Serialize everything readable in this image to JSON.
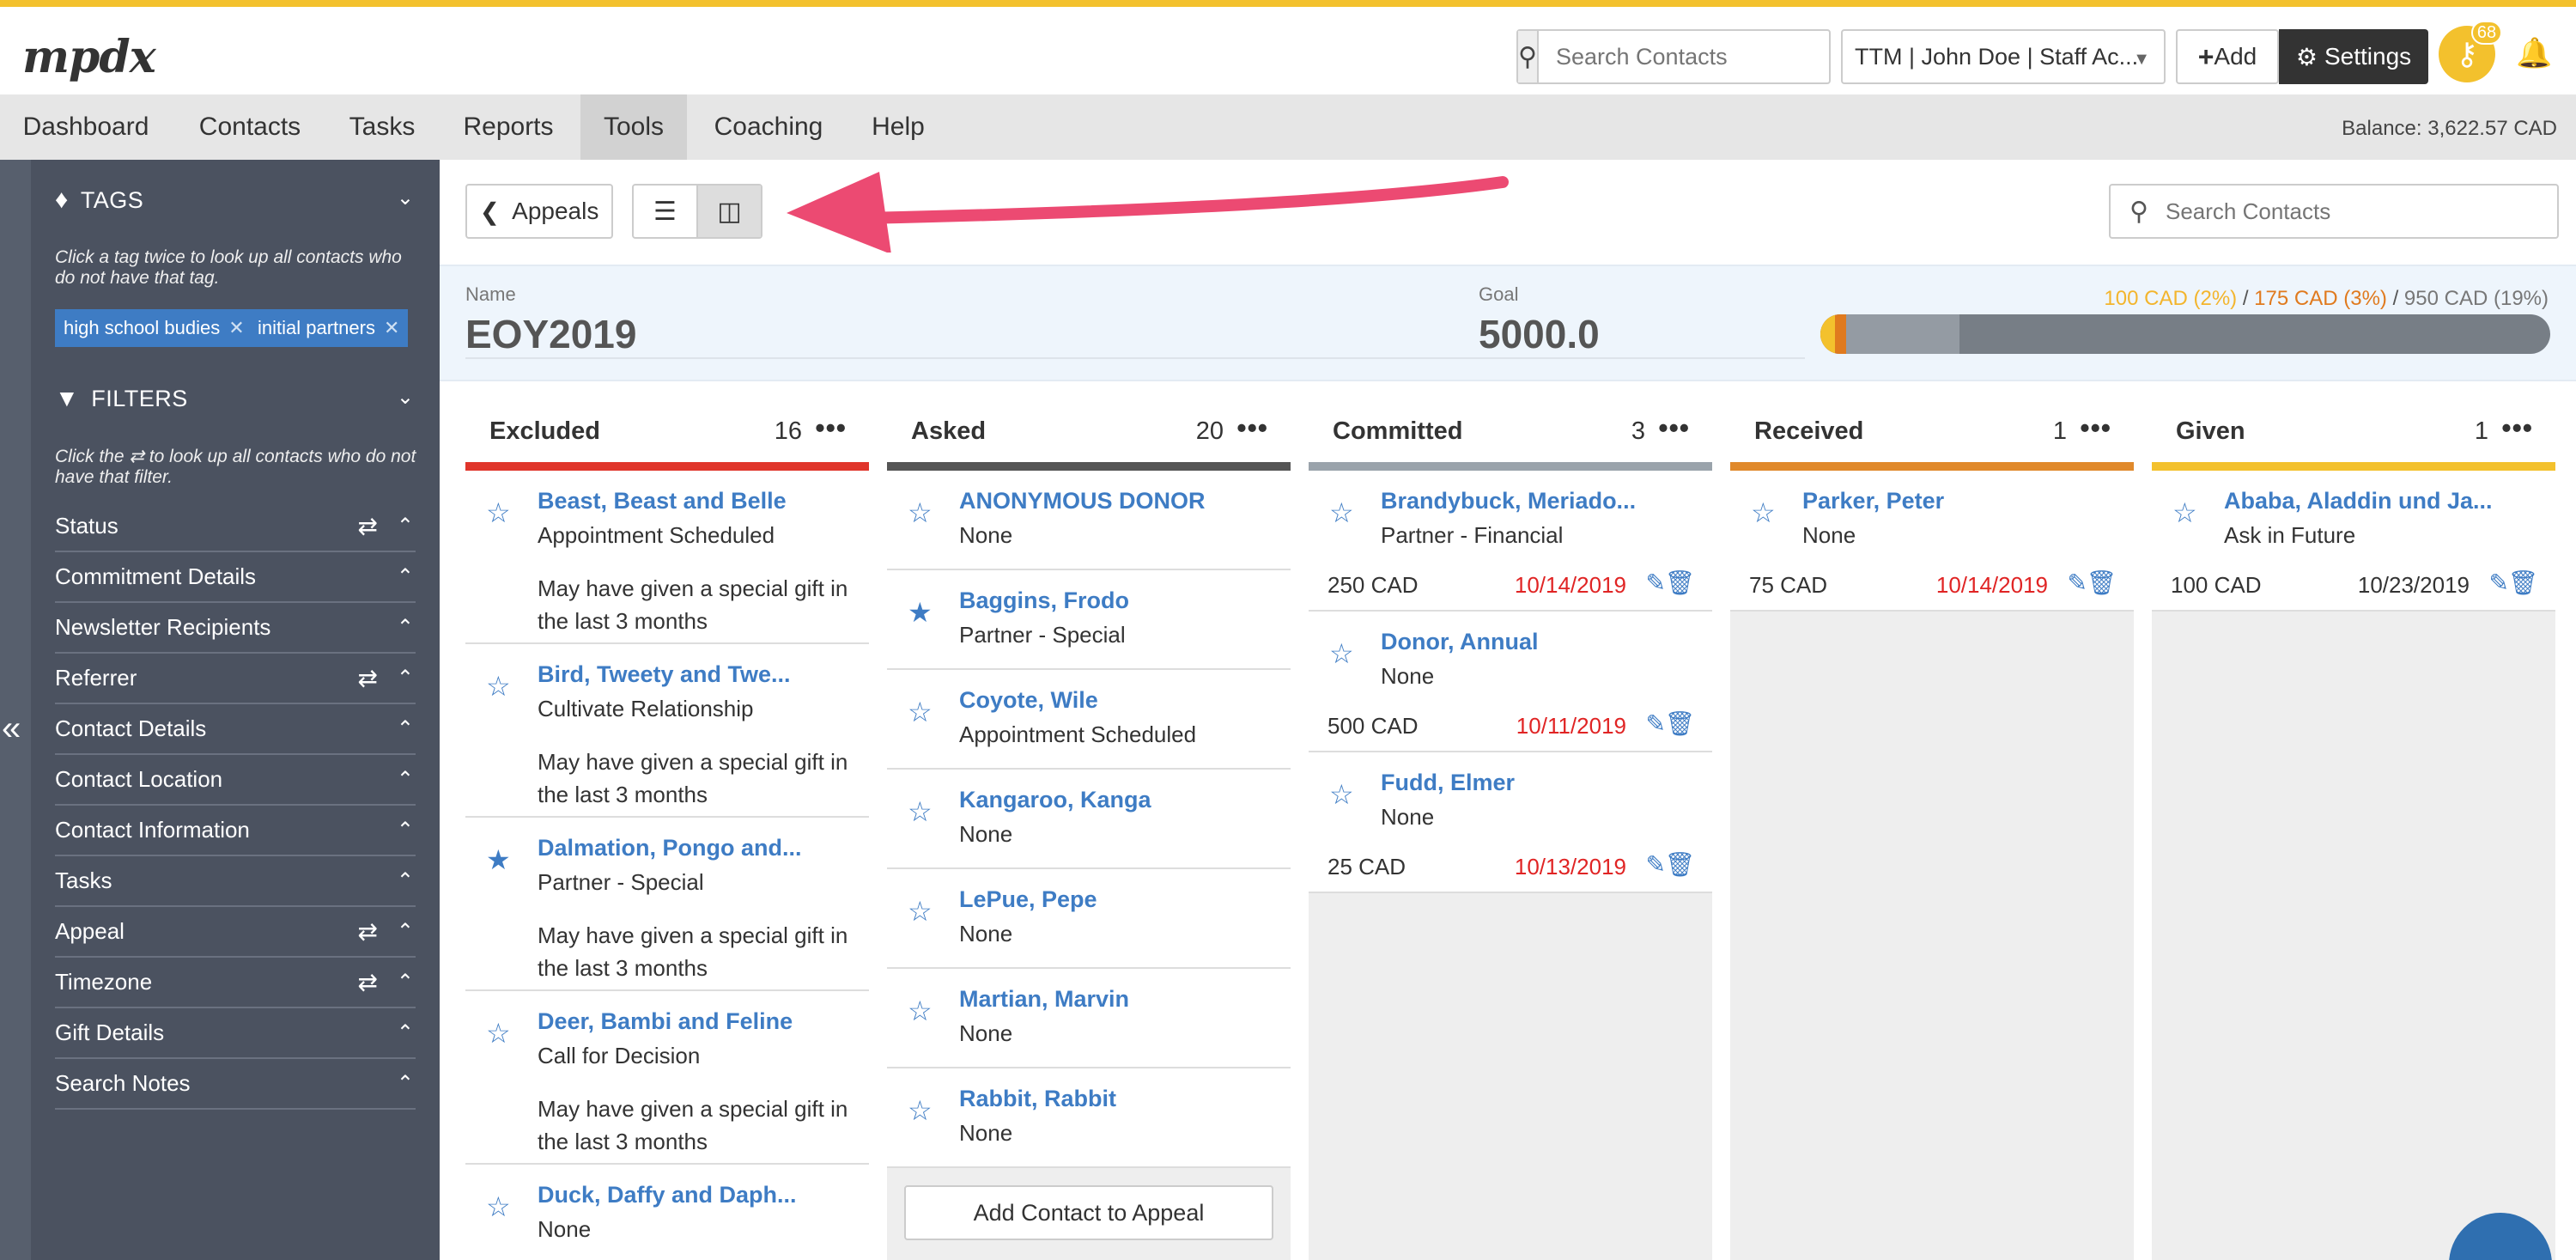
{
  "topbar": {
    "logo": "mpdx",
    "search_placeholder": "Search Contacts",
    "account": "TTM | John Doe | Staff Ac...",
    "add_label": "Add",
    "settings_label": "Settings",
    "notification_count": "68"
  },
  "nav": {
    "items": [
      "Dashboard",
      "Contacts",
      "Tasks",
      "Reports",
      "Tools",
      "Coaching",
      "Help"
    ],
    "active": "Tools",
    "balance": "Balance: 3,622.57 CAD"
  },
  "sidebar": {
    "tags_heading": "TAGS",
    "tags_hint": "Click a tag twice to look up all contacts who do not have that tag.",
    "tags": [
      "high school budies",
      "initial partners"
    ],
    "filters_heading": "FILTERS",
    "filters_hint": "Click the ⇄ to look up all contacts who do not have that filter.",
    "filters": [
      {
        "label": "Status",
        "swap": true
      },
      {
        "label": "Commitment Details",
        "swap": false
      },
      {
        "label": "Newsletter Recipients",
        "swap": false
      },
      {
        "label": "Referrer",
        "swap": true
      },
      {
        "label": "Contact Details",
        "swap": false
      },
      {
        "label": "Contact Location",
        "swap": false
      },
      {
        "label": "Contact Information",
        "swap": false
      },
      {
        "label": "Tasks",
        "swap": false
      },
      {
        "label": "Appeal",
        "swap": true
      },
      {
        "label": "Timezone",
        "swap": true
      },
      {
        "label": "Gift Details",
        "swap": false
      },
      {
        "label": "Search Notes",
        "swap": false
      }
    ]
  },
  "toolbar": {
    "back_label": "Appeals",
    "search_placeholder": "Search Contacts"
  },
  "appeal": {
    "name_label": "Name",
    "name": "EOY2019",
    "goal_label": "Goal",
    "goal": "5000.0",
    "amount_given": "100 CAD (2%)",
    "amount_received": "175 CAD (3%)",
    "amount_committed": "950 CAD (19%)",
    "progress": {
      "given": 0.02,
      "received": 0.035,
      "committed": 0.19
    }
  },
  "colors": {
    "excluded": "#e0352b",
    "asked": "#555555",
    "committed": "#9aa3ab",
    "received": "#e0892b",
    "given": "#f3c12d",
    "link": "#3e7cc4"
  },
  "columns": [
    {
      "title": "Excluded",
      "count": "16",
      "cards": [
        {
          "name": "Beast, Beast and Belle",
          "status": "Appointment Scheduled",
          "note": "May have given a special gift in the last 3 months",
          "starred": false
        },
        {
          "name": "Bird, Tweety and Twe...",
          "status": "Cultivate Relationship",
          "note": "May have given a special gift in the last 3 months",
          "starred": false
        },
        {
          "name": "Dalmation, Pongo and...",
          "status": "Partner - Special",
          "note": "May have given a special gift in the last 3 months",
          "starred": true
        },
        {
          "name": "Deer, Bambi and Feline",
          "status": "Call for Decision",
          "note": "May have given a special gift in the last 3 months",
          "starred": false
        },
        {
          "name": "Duck, Daffy and Daph...",
          "status": "None",
          "note": "",
          "starred": false
        }
      ]
    },
    {
      "title": "Asked",
      "count": "20",
      "cards": [
        {
          "name": "ANONYMOUS DONOR",
          "status": "None",
          "starred": false
        },
        {
          "name": "Baggins, Frodo",
          "status": "Partner - Special",
          "starred": true
        },
        {
          "name": "Coyote, Wile",
          "status": "Appointment Scheduled",
          "starred": false
        },
        {
          "name": "Kangaroo, Kanga",
          "status": "None",
          "starred": false
        },
        {
          "name": "LePue, Pepe",
          "status": "None",
          "starred": false
        },
        {
          "name": "Martian, Marvin",
          "status": "None",
          "starred": false
        },
        {
          "name": "Rabbit, Rabbit",
          "status": "None",
          "starred": false
        }
      ],
      "add_label": "Add Contact to Appeal"
    },
    {
      "title": "Committed",
      "count": "3",
      "cards": [
        {
          "name": "Brandybuck, Meriado...",
          "status": "Partner - Financial",
          "amount": "250 CAD",
          "date": "10/14/2019",
          "starred": false
        },
        {
          "name": "Donor, Annual",
          "status": "None",
          "amount": "500 CAD",
          "date": "10/11/2019",
          "starred": false
        },
        {
          "name": "Fudd, Elmer",
          "status": "None",
          "amount": "25 CAD",
          "date": "10/13/2019",
          "starred": false
        }
      ]
    },
    {
      "title": "Received",
      "count": "1",
      "cards": [
        {
          "name": "Parker, Peter",
          "status": "None",
          "amount": "75 CAD",
          "date": "10/14/2019",
          "starred": false
        }
      ]
    },
    {
      "title": "Given",
      "count": "1",
      "cards": [
        {
          "name": "Ababa, Aladdin und Ja...",
          "status": "Ask in Future",
          "amount": "100 CAD",
          "date": "10/23/2019",
          "starred": false
        }
      ]
    }
  ]
}
